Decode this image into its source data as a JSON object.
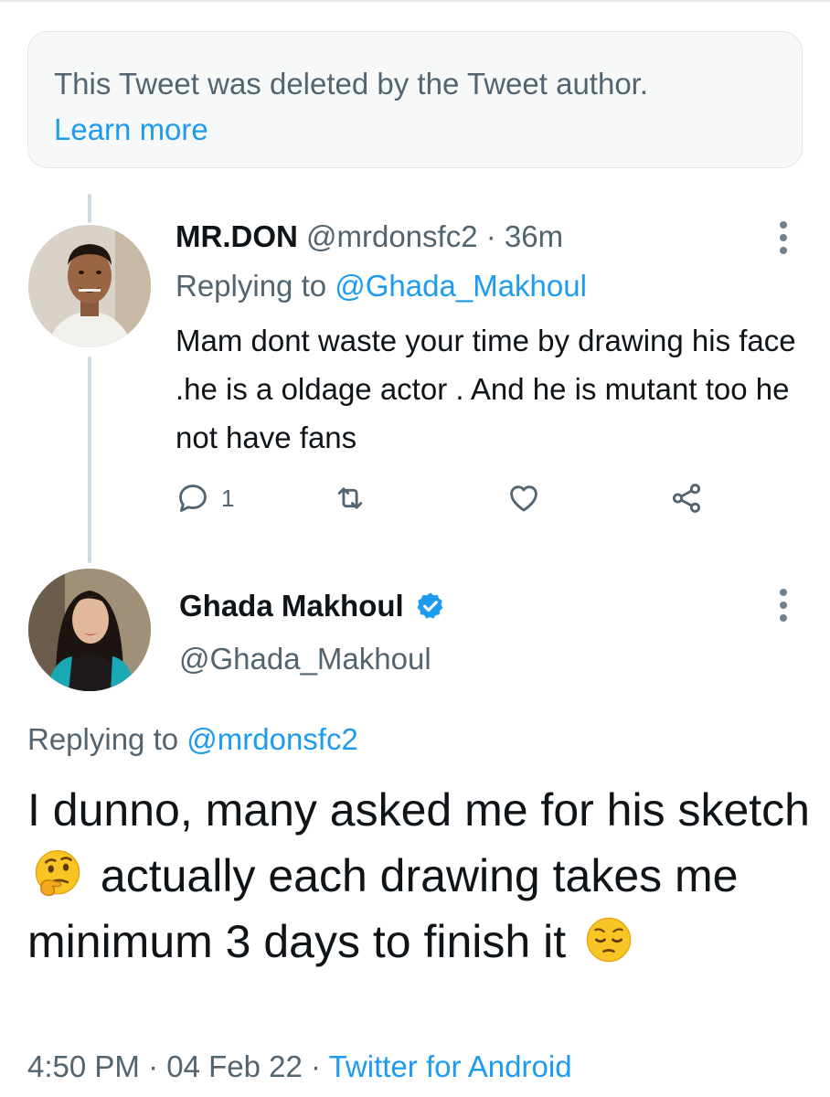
{
  "deleted_notice": {
    "text": "This Tweet was deleted by the Tweet author.",
    "link": "Learn more"
  },
  "reply": {
    "display_name": "MR.DON",
    "handle": "@mrdonsfc2",
    "separator": " · ",
    "time": "36m",
    "replying_prefix": "Replying to ",
    "replying_to": "@Ghada_Makhoul",
    "body": "Mam dont waste your time by drawing his face .he is a oldage actor . And he is mutant too he not have fans",
    "reply_count": "1"
  },
  "main_tweet": {
    "display_name": "Ghada Makhoul",
    "handle": "@Ghada_Makhoul",
    "replying_prefix": "Replying to ",
    "replying_to": "@mrdonsfc2",
    "text_part1": "I dunno, many asked me for his sketch",
    "text_part2": "actually each drawing takes me minimum 3 days to finish it",
    "emoji1": "thinking-face",
    "emoji2": "pensive-face",
    "time": "4:50 PM",
    "dot1": " · ",
    "date": "04 Feb 22",
    "dot2": " · ",
    "source": "Twitter for Android"
  },
  "colors": {
    "accent": "#1d9bf0",
    "muted": "#536471",
    "text": "#0f1419"
  }
}
